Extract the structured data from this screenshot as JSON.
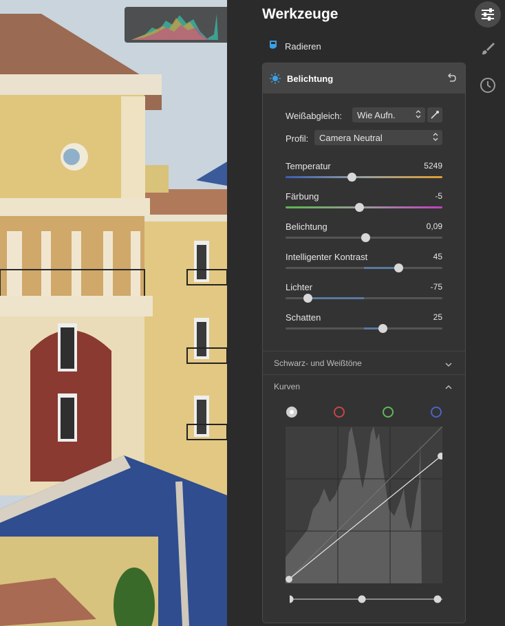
{
  "panel": {
    "title": "Werkzeuge",
    "erase_label": "Radieren",
    "side_icons": [
      "sliders-icon",
      "brush-icon",
      "clock-icon"
    ]
  },
  "exposure": {
    "title": "Belichtung",
    "white_balance": {
      "label": "Weißabgleich:",
      "value": "Wie Aufn."
    },
    "profile": {
      "label": "Profil:",
      "value": "Camera Neutral"
    },
    "sliders": [
      {
        "label": "Temperatur",
        "value": "5249",
        "position": 0.42
      },
      {
        "label": "Färbung",
        "value": "-5",
        "position": 0.47
      },
      {
        "label": "Belichtung",
        "value": "0,09",
        "position": 0.51
      },
      {
        "label": "Intelligenter Kontrast",
        "value": "45",
        "position": 0.72
      },
      {
        "label": "Lichter",
        "value": "-75",
        "position": 0.14
      },
      {
        "label": "Schatten",
        "value": "25",
        "position": 0.62
      }
    ]
  },
  "sections": {
    "black_white": "Schwarz- und Weißtöne",
    "curves": "Kurven"
  },
  "curves": {
    "channels": [
      "luminance",
      "red",
      "green",
      "blue"
    ],
    "channel_colors": [
      "#d0d0d0",
      "#c84646",
      "#5fb85a",
      "#4a64c8"
    ],
    "selected_channel": "luminance"
  },
  "colors": {
    "accent": "#3aa0e6",
    "panel_bg": "#2b2b2b",
    "card_bg": "#333333"
  }
}
